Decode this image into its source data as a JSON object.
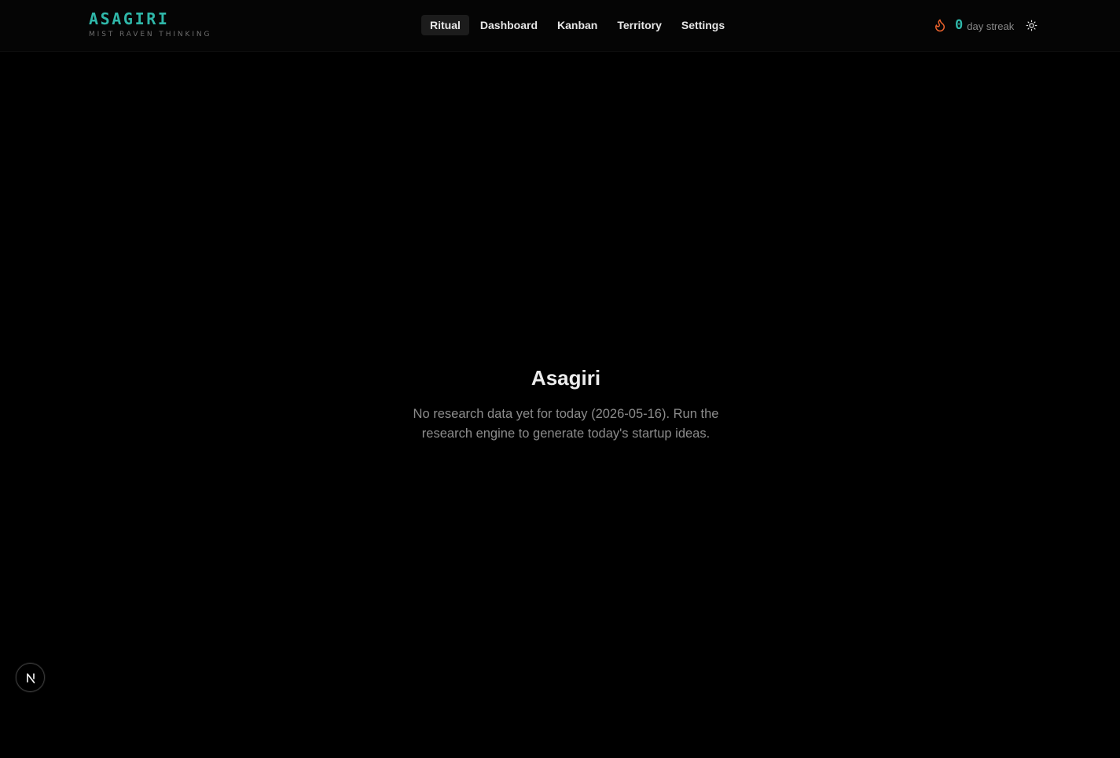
{
  "brand": {
    "title": "ASAGIRI",
    "subtitle": "MIST RAVEN THINKING",
    "accent_color": "#2fb7a9"
  },
  "nav": {
    "items": [
      {
        "label": "Ritual",
        "active": true
      },
      {
        "label": "Dashboard",
        "active": false
      },
      {
        "label": "Kanban",
        "active": false
      },
      {
        "label": "Territory",
        "active": false
      },
      {
        "label": "Settings",
        "active": false
      }
    ]
  },
  "streak": {
    "icon": "flame-icon",
    "icon_color": "#e8612c",
    "count": "0",
    "label": "day streak"
  },
  "theme_toggle": {
    "icon": "sun-icon"
  },
  "empty_state": {
    "title": "Asagiri",
    "message": "No research data yet for today (2026-05-16). Run the research engine to generate today's startup ideas."
  },
  "dev_badge": {
    "icon": "nextjs-logo-icon"
  }
}
